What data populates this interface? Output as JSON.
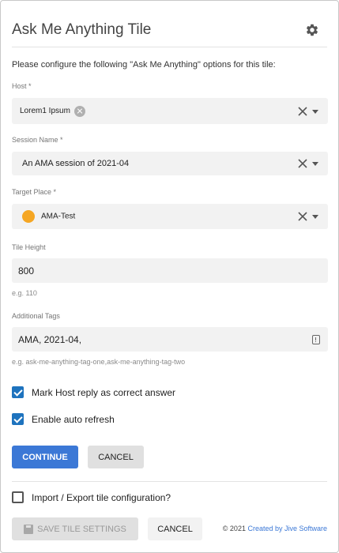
{
  "header": {
    "title": "Ask Me Anything Tile",
    "settings_icon": "gear-icon"
  },
  "intro": "Please configure the following \"Ask Me Anything\" options for this tile:",
  "host": {
    "label": "Host *",
    "value": "Lorem1 Ipsum"
  },
  "session": {
    "label": "Session Name *",
    "value": "An AMA session of 2021-04"
  },
  "place": {
    "label": "Target Place *",
    "value": "AMA-Test",
    "icon_color": "#f5a623"
  },
  "tile_height": {
    "label": "Tile Height",
    "value": "800",
    "helper": "e.g. 110"
  },
  "tags": {
    "label": "Additional Tags",
    "value": "AMA, 2021-04,",
    "helper": "e.g. ask-me-anything-tag-one,ask-me-anything-tag-two"
  },
  "options": {
    "mark_host": {
      "label": "Mark Host reply as correct answer",
      "checked": true
    },
    "auto_refresh": {
      "label": "Enable auto refresh",
      "checked": true
    }
  },
  "actions": {
    "continue_label": "CONTINUE",
    "cancel_label": "CANCEL"
  },
  "import_export": {
    "label": "Import / Export tile configuration?",
    "checked": false
  },
  "footer": {
    "save_label": "SAVE TILE SETTINGS",
    "cancel_label": "CANCEL",
    "copyright": "© 2021 ",
    "credit_link": "Created by Jive Software"
  },
  "colors": {
    "accent": "#3b78d6",
    "checkbox": "#1e73be"
  }
}
